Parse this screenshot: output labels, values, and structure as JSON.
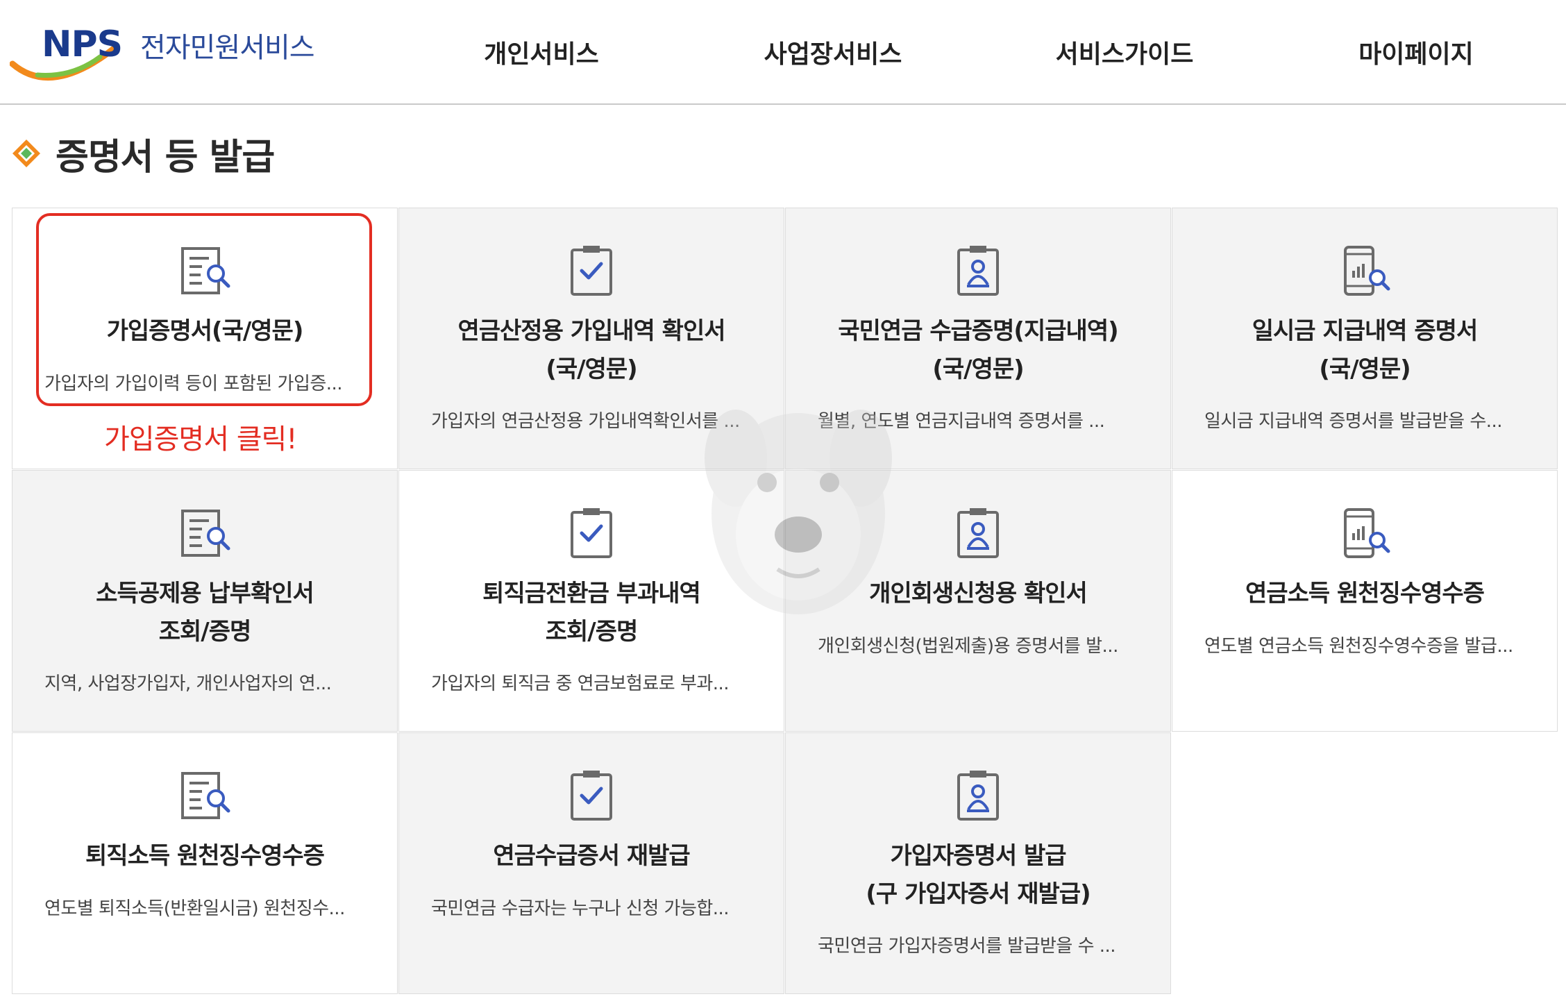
{
  "header": {
    "logo_abbr": "NPS",
    "logo_text": "전자민원서비스",
    "nav": [
      "개인서비스",
      "사업장서비스",
      "서비스가이드",
      "마이페이지"
    ]
  },
  "page": {
    "title": "증명서 등 발급"
  },
  "tiles": [
    {
      "icon": "document-search-icon",
      "title_lines": [
        "가입증명서(국/영문)"
      ],
      "desc": "가입자의 가입이력 등이 포함된 가입증..."
    },
    {
      "icon": "clipboard-check-icon",
      "title_lines": [
        "연금산정용 가입내역 확인서",
        "(국/영문)"
      ],
      "desc": "가입자의 연금산정용 가입내역확인서를 ..."
    },
    {
      "icon": "person-card-icon",
      "title_lines": [
        "국민연금 수급증명(지급내역)",
        "(국/영문)"
      ],
      "desc": "월별, 연도별 연금지급내역 증명서를 ..."
    },
    {
      "icon": "phone-chart-search-icon",
      "title_lines": [
        "일시금 지급내역 증명서",
        "(국/영문)"
      ],
      "desc": "일시금 지급내역 증명서를 발급받을 수..."
    },
    {
      "icon": "document-search-icon",
      "title_lines": [
        "소득공제용 납부확인서",
        "조회/증명"
      ],
      "desc": "지역, 사업장가입자, 개인사업자의 연..."
    },
    {
      "icon": "clipboard-check-icon",
      "title_lines": [
        "퇴직금전환금 부과내역",
        "조회/증명"
      ],
      "desc": "가입자의 퇴직금 중 연금보험료로 부과..."
    },
    {
      "icon": "person-card-icon",
      "title_lines": [
        "개인회생신청용 확인서"
      ],
      "desc": "개인회생신청(법원제출)용 증명서를 발..."
    },
    {
      "icon": "phone-chart-search-icon",
      "title_lines": [
        "연금소득 원천징수영수증"
      ],
      "desc": "연도별 연금소득 원천징수영수증을 발급..."
    },
    {
      "icon": "document-search-icon",
      "title_lines": [
        "퇴직소득 원천징수영수증"
      ],
      "desc": "연도별 퇴직소득(반환일시금) 원천징수..."
    },
    {
      "icon": "clipboard-check-icon",
      "title_lines": [
        "연금수급증서 재발급"
      ],
      "desc": "국민연금 수급자는 누구나 신청 가능합..."
    },
    {
      "icon": "person-card-icon",
      "title_lines": [
        "가입자증명서 발급",
        "(구 가입자증서 재발급)"
      ],
      "desc": "국민연금 가입자증명서를 발급받을 수 ..."
    }
  ],
  "annotation": {
    "callout": "가입증명서 클릭!"
  },
  "colors": {
    "accent_red": "#e32d22",
    "icon_blue": "#3a5bbf",
    "icon_gray": "#6a6a6a",
    "alt_bg": "#f3f3f3"
  }
}
